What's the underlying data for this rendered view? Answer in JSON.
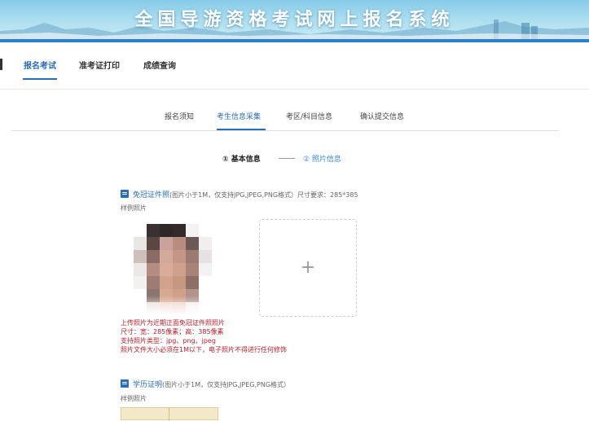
{
  "header": {
    "title": "全国导游资格考试网上报名系统"
  },
  "topnav": {
    "items": [
      {
        "label": "报名考试",
        "active": true
      },
      {
        "label": "准考证打印",
        "active": false
      },
      {
        "label": "成绩查询",
        "active": false
      }
    ]
  },
  "subtabs": {
    "items": [
      {
        "label": "报名须知",
        "active": false
      },
      {
        "label": "考生信息采集",
        "active": true
      },
      {
        "label": "考区/科目信息",
        "active": false
      },
      {
        "label": "确认提交信息",
        "active": false
      }
    ]
  },
  "steps": {
    "step1": "① 基本信息",
    "step2": "② 照片信息"
  },
  "photo_section": {
    "title": "免冠证件照",
    "hint": "(图片小于1M，仅支持JPG,JPEG,PNG格式）尺寸要求：285*385",
    "sample_label": "样例照片",
    "upload_symbol": "+",
    "requirements": [
      "上传照片为近期正面免冠证件照照片",
      "尺寸：宽：285像素；高：385像素",
      "支持照片类型：jpg、png、jpeg",
      "照片文件大小必须在1M以下，电子照片不得进行任何修饰"
    ]
  },
  "edu_section": {
    "title": "学历证明",
    "hint": "(图片小于1M，仅支持JPG,JPEG,PNG格式）",
    "sample_label": "样例照片"
  },
  "colors": {
    "accent": "#2a6db5",
    "step_current": "#3a8ad6",
    "warning_text": "#b8202e"
  }
}
